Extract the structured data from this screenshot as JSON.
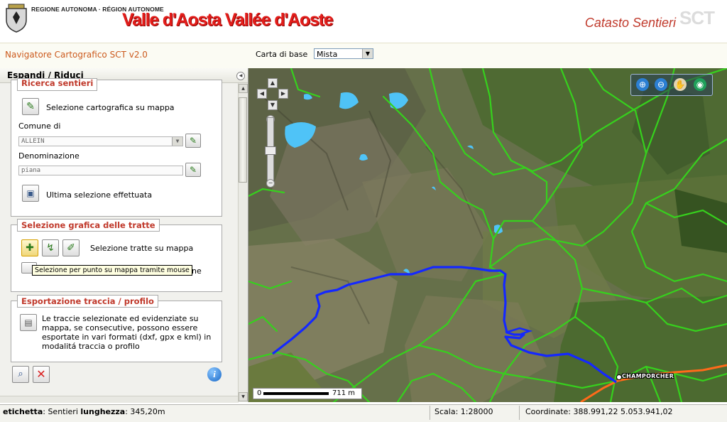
{
  "header": {
    "region_small": "REGIONE AUTONOMA · RÉGION AUTONOME",
    "region_big": "Valle d'Aosta Vallée d'Aoste",
    "app_title": "Catasto Sentieri",
    "app_code": "SCT",
    "brand_color": "#e31d1a"
  },
  "toolbar": {
    "nav_version": "Navigatore Cartografico SCT v2.0",
    "basemap_label": "Carta di base",
    "basemap_value": "Mista"
  },
  "panel": {
    "title": "Espandi / Riduci",
    "search": {
      "legend": "Ricerca sentieri",
      "map_select_label": "Selezione cartografica su mappa",
      "comune_label": "Comune di",
      "comune_value": "ALLEIN",
      "denominazione_label": "Denominazione",
      "denominazione_value": "piana",
      "last_selection_label": "Ultima selezione effettuata"
    },
    "graphic": {
      "legend": "Selezione grafica delle tratte",
      "select_label": "Selezione tratte su mappa",
      "partial_label": "ne",
      "tooltip": "Selezione per punto su mappa tramite mouse"
    },
    "export": {
      "legend": "Esportazione traccia / profilo",
      "text": "Le traccie selezionate ed evidenziate su mappa, se consecutive, possono essere esportate in vari formati (dxf, gpx e kml) in modalitá traccia o profilo"
    }
  },
  "map": {
    "scale_zero": "0",
    "scale_distance": "711 m",
    "place_label": "CHAMPORCHER",
    "trail_color": "#36d11d",
    "selected_color": "#1428ff",
    "road_color": "#ff6a1a"
  },
  "statusbar": {
    "etichetta_key": "etichetta",
    "etichetta_value": ": Sentieri ",
    "lunghezza_key": "lunghezza",
    "lunghezza_value": ": 345,20m",
    "scala": "Scala: 1:28000",
    "coordinate": "Coordinate: 388.991,22 5.053.941,02"
  }
}
